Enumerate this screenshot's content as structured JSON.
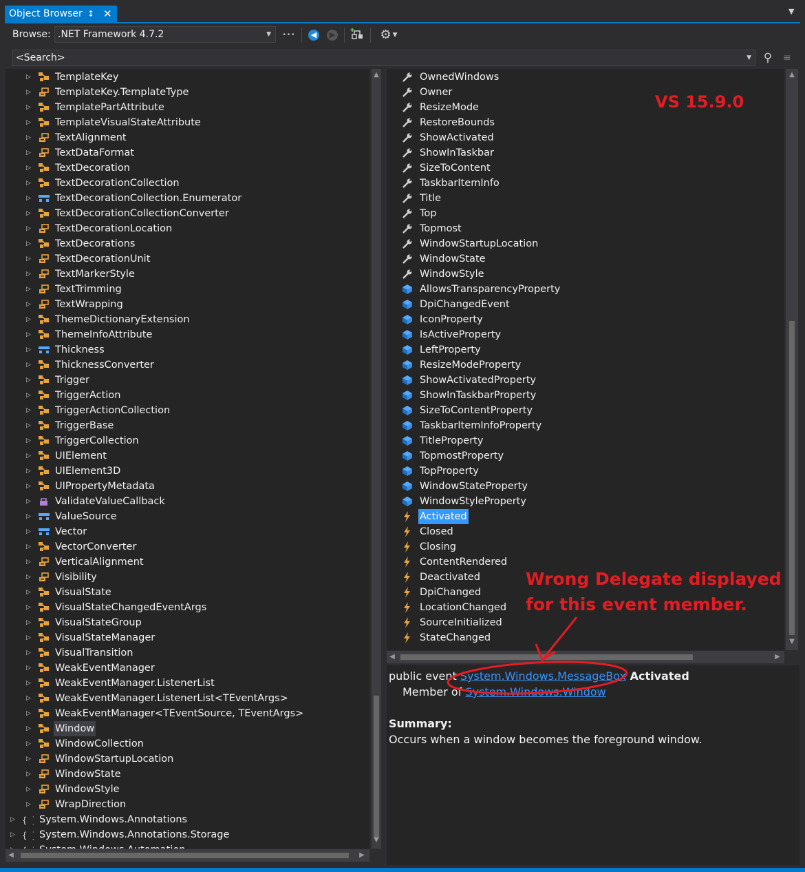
{
  "tab": {
    "title": "Object Browser",
    "pin": "↕",
    "close": "✕"
  },
  "toolbar": {
    "browse_label": "Browse:",
    "browse_value": ".NET Framework 4.7.2",
    "more": "•••",
    "settings_icon": "gear-icon"
  },
  "search": {
    "placeholder": "<Search>"
  },
  "left_tree": [
    {
      "label": "TemplateKey",
      "icon": "class",
      "indent": 1
    },
    {
      "label": "TemplateKey.TemplateType",
      "icon": "enum",
      "indent": 1
    },
    {
      "label": "TemplatePartAttribute",
      "icon": "class",
      "indent": 1
    },
    {
      "label": "TemplateVisualStateAttribute",
      "icon": "class",
      "indent": 1
    },
    {
      "label": "TextAlignment",
      "icon": "enum",
      "indent": 1
    },
    {
      "label": "TextDataFormat",
      "icon": "enum",
      "indent": 1
    },
    {
      "label": "TextDecoration",
      "icon": "class",
      "indent": 1
    },
    {
      "label": "TextDecorationCollection",
      "icon": "class",
      "indent": 1
    },
    {
      "label": "TextDecorationCollection.Enumerator",
      "icon": "struct",
      "indent": 1
    },
    {
      "label": "TextDecorationCollectionConverter",
      "icon": "class",
      "indent": 1
    },
    {
      "label": "TextDecorationLocation",
      "icon": "enum",
      "indent": 1
    },
    {
      "label": "TextDecorations",
      "icon": "class",
      "indent": 1
    },
    {
      "label": "TextDecorationUnit",
      "icon": "enum",
      "indent": 1
    },
    {
      "label": "TextMarkerStyle",
      "icon": "enum",
      "indent": 1
    },
    {
      "label": "TextTrimming",
      "icon": "enum",
      "indent": 1
    },
    {
      "label": "TextWrapping",
      "icon": "enum",
      "indent": 1
    },
    {
      "label": "ThemeDictionaryExtension",
      "icon": "class",
      "indent": 1
    },
    {
      "label": "ThemeInfoAttribute",
      "icon": "class",
      "indent": 1
    },
    {
      "label": "Thickness",
      "icon": "struct",
      "indent": 1
    },
    {
      "label": "ThicknessConverter",
      "icon": "class",
      "indent": 1
    },
    {
      "label": "Trigger",
      "icon": "class",
      "indent": 1
    },
    {
      "label": "TriggerAction",
      "icon": "class",
      "indent": 1
    },
    {
      "label": "TriggerActionCollection",
      "icon": "class",
      "indent": 1
    },
    {
      "label": "TriggerBase",
      "icon": "class",
      "indent": 1
    },
    {
      "label": "TriggerCollection",
      "icon": "class",
      "indent": 1
    },
    {
      "label": "UIElement",
      "icon": "class",
      "indent": 1
    },
    {
      "label": "UIElement3D",
      "icon": "class",
      "indent": 1
    },
    {
      "label": "UIPropertyMetadata",
      "icon": "class",
      "indent": 1
    },
    {
      "label": "ValidateValueCallback",
      "icon": "delegate",
      "indent": 1
    },
    {
      "label": "ValueSource",
      "icon": "struct",
      "indent": 1
    },
    {
      "label": "Vector",
      "icon": "struct",
      "indent": 1
    },
    {
      "label": "VectorConverter",
      "icon": "class",
      "indent": 1
    },
    {
      "label": "VerticalAlignment",
      "icon": "enum",
      "indent": 1
    },
    {
      "label": "Visibility",
      "icon": "enum",
      "indent": 1
    },
    {
      "label": "VisualState",
      "icon": "class",
      "indent": 1
    },
    {
      "label": "VisualStateChangedEventArgs",
      "icon": "class",
      "indent": 1
    },
    {
      "label": "VisualStateGroup",
      "icon": "class",
      "indent": 1
    },
    {
      "label": "VisualStateManager",
      "icon": "class",
      "indent": 1
    },
    {
      "label": "VisualTransition",
      "icon": "class",
      "indent": 1
    },
    {
      "label": "WeakEventManager",
      "icon": "class",
      "indent": 1
    },
    {
      "label": "WeakEventManager.ListenerList",
      "icon": "class",
      "indent": 1
    },
    {
      "label": "WeakEventManager.ListenerList<TEventArgs>",
      "icon": "class",
      "indent": 1
    },
    {
      "label": "WeakEventManager<TEventSource, TEventArgs>",
      "icon": "class",
      "indent": 1
    },
    {
      "label": "Window",
      "icon": "class",
      "indent": 1,
      "selected": true
    },
    {
      "label": "WindowCollection",
      "icon": "class",
      "indent": 1
    },
    {
      "label": "WindowStartupLocation",
      "icon": "enum",
      "indent": 1
    },
    {
      "label": "WindowState",
      "icon": "enum",
      "indent": 1
    },
    {
      "label": "WindowStyle",
      "icon": "enum",
      "indent": 1
    },
    {
      "label": "WrapDirection",
      "icon": "enum",
      "indent": 1
    },
    {
      "label": "System.Windows.Annotations",
      "icon": "namespace",
      "indent": 0
    },
    {
      "label": "System.Windows.Annotations.Storage",
      "icon": "namespace",
      "indent": 0
    },
    {
      "label": "System.Windows.Automation",
      "icon": "namespace",
      "indent": 0
    }
  ],
  "right_members": [
    {
      "label": "OwnedWindows",
      "icon": "property"
    },
    {
      "label": "Owner",
      "icon": "property"
    },
    {
      "label": "ResizeMode",
      "icon": "property"
    },
    {
      "label": "RestoreBounds",
      "icon": "property"
    },
    {
      "label": "ShowActivated",
      "icon": "property"
    },
    {
      "label": "ShowInTaskbar",
      "icon": "property"
    },
    {
      "label": "SizeToContent",
      "icon": "property"
    },
    {
      "label": "TaskbarItemInfo",
      "icon": "property"
    },
    {
      "label": "Title",
      "icon": "property"
    },
    {
      "label": "Top",
      "icon": "property"
    },
    {
      "label": "Topmost",
      "icon": "property"
    },
    {
      "label": "WindowStartupLocation",
      "icon": "property"
    },
    {
      "label": "WindowState",
      "icon": "property"
    },
    {
      "label": "WindowStyle",
      "icon": "property"
    },
    {
      "label": "AllowsTransparencyProperty",
      "icon": "field"
    },
    {
      "label": "DpiChangedEvent",
      "icon": "field"
    },
    {
      "label": "IconProperty",
      "icon": "field"
    },
    {
      "label": "IsActiveProperty",
      "icon": "field"
    },
    {
      "label": "LeftProperty",
      "icon": "field"
    },
    {
      "label": "ResizeModeProperty",
      "icon": "field"
    },
    {
      "label": "ShowActivatedProperty",
      "icon": "field"
    },
    {
      "label": "ShowInTaskbarProperty",
      "icon": "field"
    },
    {
      "label": "SizeToContentProperty",
      "icon": "field"
    },
    {
      "label": "TaskbarItemInfoProperty",
      "icon": "field"
    },
    {
      "label": "TitleProperty",
      "icon": "field"
    },
    {
      "label": "TopmostProperty",
      "icon": "field"
    },
    {
      "label": "TopProperty",
      "icon": "field"
    },
    {
      "label": "WindowStateProperty",
      "icon": "field"
    },
    {
      "label": "WindowStyleProperty",
      "icon": "field"
    },
    {
      "label": "Activated",
      "icon": "event",
      "selected": true
    },
    {
      "label": "Closed",
      "icon": "event"
    },
    {
      "label": "Closing",
      "icon": "event"
    },
    {
      "label": "ContentRendered",
      "icon": "event"
    },
    {
      "label": "Deactivated",
      "icon": "event"
    },
    {
      "label": "DpiChanged",
      "icon": "event"
    },
    {
      "label": "LocationChanged",
      "icon": "event"
    },
    {
      "label": "SourceInitialized",
      "icon": "event"
    },
    {
      "label": "StateChanged",
      "icon": "event"
    }
  ],
  "description": {
    "prefix": "public event ",
    "delegate_link": "System.Windows.MessageBox",
    "member_name": " Activated",
    "member_of_prefix": "Member of ",
    "member_of_ns": "System.Windows",
    "member_of_dot": ".",
    "member_of_class": "Window",
    "summary_heading": "Summary:",
    "summary_text": "Occurs when a window becomes the foreground window."
  },
  "annotations": {
    "version": "VS 15.9.0",
    "note_line1": "Wrong Delegate displayed",
    "note_line2": "for this event member."
  },
  "colors": {
    "accent": "#007acc",
    "annotation_red": "#e51c23",
    "link": "#3794ff",
    "selection_blue": "#3399ff"
  }
}
